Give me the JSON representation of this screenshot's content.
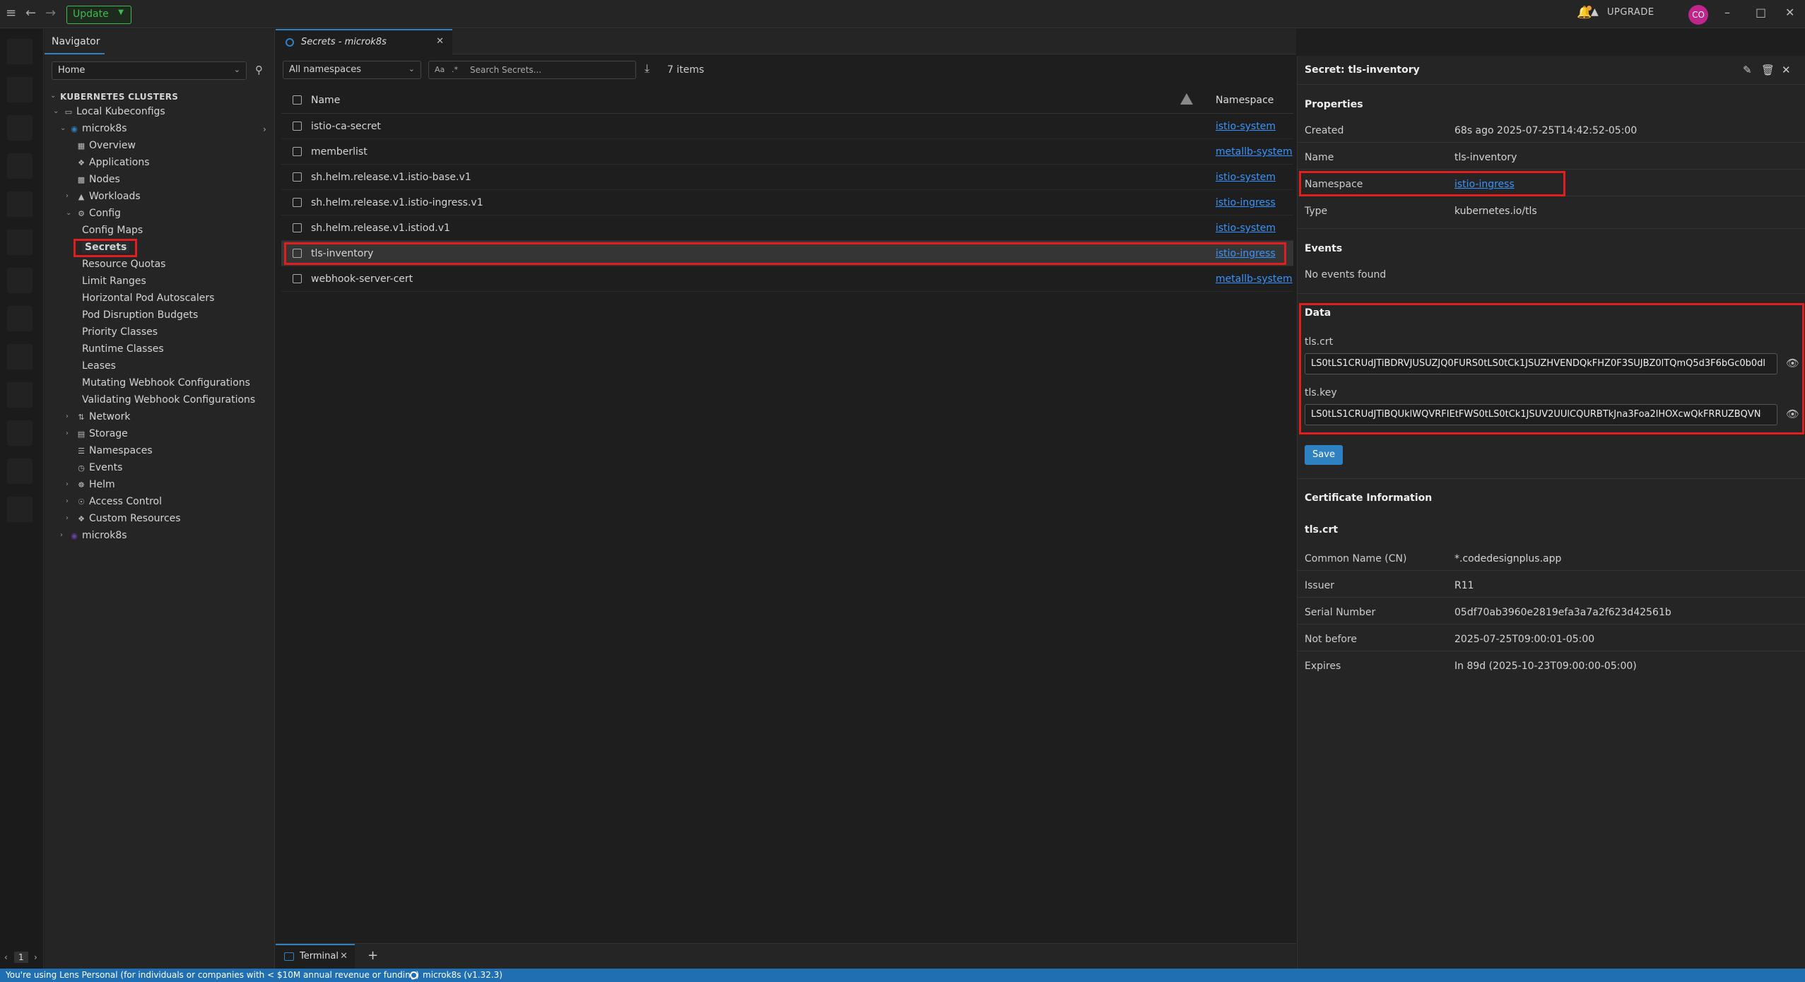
{
  "topbar": {
    "update_label": "Update",
    "upgrade_label": "UPGRADE",
    "avatar_initials": "CO"
  },
  "navigator": {
    "title": "Navigator",
    "select_value": "Home",
    "section_header": "KUBERNETES CLUSTERS",
    "local_kubeconfigs": "Local Kubeconfigs",
    "cluster_name": "microk8s",
    "items": {
      "overview": "Overview",
      "applications": "Applications",
      "nodes": "Nodes",
      "workloads": "Workloads",
      "config": "Config",
      "config_maps": "Config Maps",
      "secrets": "Secrets",
      "resource_quotas": "Resource Quotas",
      "limit_ranges": "Limit Ranges",
      "hpa": "Horizontal Pod Autoscalers",
      "pdb": "Pod Disruption Budgets",
      "priority_classes": "Priority Classes",
      "runtime_classes": "Runtime Classes",
      "leases": "Leases",
      "mutating": "Mutating Webhook Configurations",
      "validating": "Validating Webhook Configurations",
      "network": "Network",
      "storage": "Storage",
      "namespaces": "Namespaces",
      "events": "Events",
      "helm": "Helm",
      "access_control": "Access Control",
      "custom_resources": "Custom Resources"
    },
    "second_cluster": "microk8s"
  },
  "center": {
    "tab_label": "Secrets - microk8s",
    "namespace_filter": "All namespaces",
    "search_placeholder": "Search Secrets...",
    "search_opt_case": "Aa",
    "search_opt_regex": ".*",
    "items_count": "7 items",
    "columns": {
      "name": "Name",
      "namespace": "Namespace"
    },
    "rows": [
      {
        "name": "istio-ca-secret",
        "namespace": "istio-system"
      },
      {
        "name": "memberlist",
        "namespace": "metallb-system"
      },
      {
        "name": "sh.helm.release.v1.istio-base.v1",
        "namespace": "istio-system"
      },
      {
        "name": "sh.helm.release.v1.istio-ingress.v1",
        "namespace": "istio-ingress"
      },
      {
        "name": "sh.helm.release.v1.istiod.v1",
        "namespace": "istio-system"
      },
      {
        "name": "tls-inventory",
        "namespace": "istio-ingress"
      },
      {
        "name": "webhook-server-cert",
        "namespace": "metallb-system"
      }
    ],
    "terminal_tab": "Terminal"
  },
  "details": {
    "title": "Secret: tls-inventory",
    "properties_title": "Properties",
    "props": {
      "created_k": "Created",
      "created_v": "68s ago 2025-07-25T14:42:52-05:00",
      "name_k": "Name",
      "name_v": "tls-inventory",
      "namespace_k": "Namespace",
      "namespace_v": "istio-ingress",
      "type_k": "Type",
      "type_v": "kubernetes.io/tls"
    },
    "events_title": "Events",
    "events_empty": "No events found",
    "data_title": "Data",
    "data": {
      "crt_label": "tls.crt",
      "crt_value": "LS0tLS1CRUdJTiBDRVJUSUZJQ0FURS0tLS0tCk1JSUZHVENDQkFHZ0F3SUJBZ0lTQmQ5d3F6bGc0b0dl",
      "key_label": "tls.key",
      "key_value": "LS0tLS1CRUdJTiBQUklWQVRFIEtFWS0tLS0tCk1JSUV2UUlCQURBTkJna3Foa2lHOXcwQkFRRUZBQVN"
    },
    "save_label": "Save",
    "cert_title": "Certificate Information",
    "cert_sub": "tls.crt",
    "cert": {
      "cn_k": "Common Name (CN)",
      "cn_v": "*.codedesignplus.app",
      "issuer_k": "Issuer",
      "issuer_v": "R11",
      "serial_k": "Serial Number",
      "serial_v": "05df70ab3960e2819efa3a7a2f623d42561b",
      "nb_k": "Not before",
      "nb_v": "2025-07-25T09:00:01-05:00",
      "exp_k": "Expires",
      "exp_v": "In 89d (2025-10-23T09:00:00-05:00)"
    }
  },
  "statusbar": {
    "text": "You're using Lens Personal (for individuals or companies with < $10M annual revenue or funding)",
    "cluster": "microk8s (v1.32.3)"
  },
  "pager": {
    "page": "1"
  },
  "colors": {
    "accent": "#2f82c2",
    "link": "#3794ff",
    "highlight": "#e01e1e",
    "status_bar": "#1f6fb2"
  }
}
